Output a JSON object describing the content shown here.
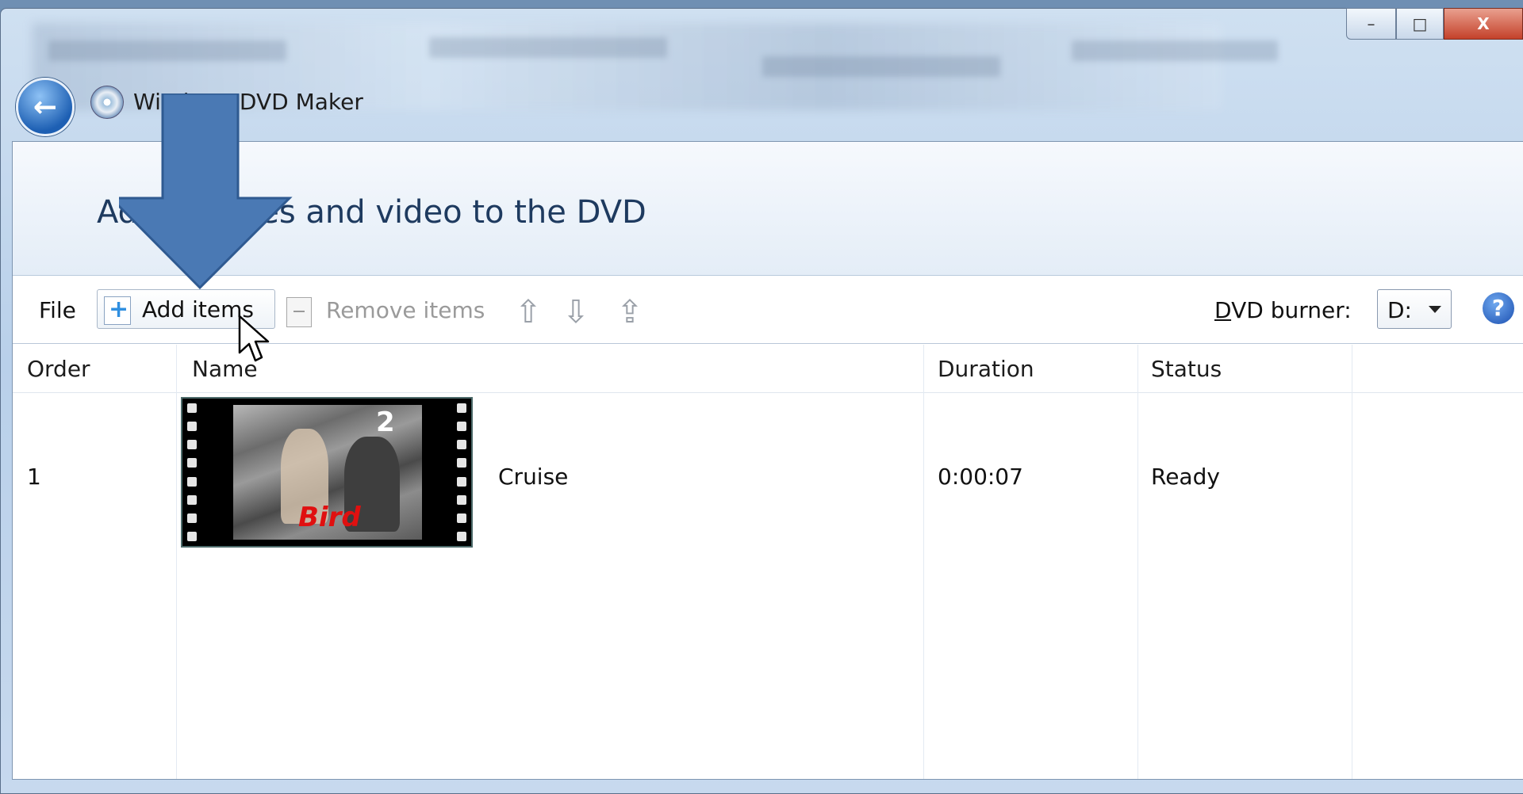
{
  "window": {
    "title": "Windows DVD Maker",
    "caption_minimize": "–",
    "caption_maximize": "□",
    "caption_close": "X"
  },
  "header": {
    "heading": "Add pictures and video to the DVD"
  },
  "toolbar": {
    "file_label": "File",
    "add_items_label": "Add items",
    "remove_items_label": "Remove items",
    "burner_label_prefix": "D",
    "burner_label_rest": "VD burner:",
    "burner_value": "D:",
    "help_label": "?"
  },
  "table": {
    "columns": [
      "Order",
      "Name",
      "Duration",
      "Status"
    ],
    "rows": [
      {
        "order": "1",
        "thumbnail_caption": "Bird",
        "thumbnail_jersey": "2",
        "name": "Cruise",
        "duration": "0:00:07",
        "status": "Ready"
      }
    ]
  },
  "icons": {
    "back": "back-arrow-icon",
    "app": "dvd-maker-icon",
    "add": "add-items-icon",
    "remove": "remove-items-icon",
    "move_up": "move-up-icon",
    "move_down": "move-down-icon",
    "move_top": "move-to-top-icon",
    "help": "help-icon"
  },
  "colors": {
    "annotation_arrow": "#4a79b4",
    "heading_text": "#1e3a5f",
    "close_button": "#c4412a"
  }
}
